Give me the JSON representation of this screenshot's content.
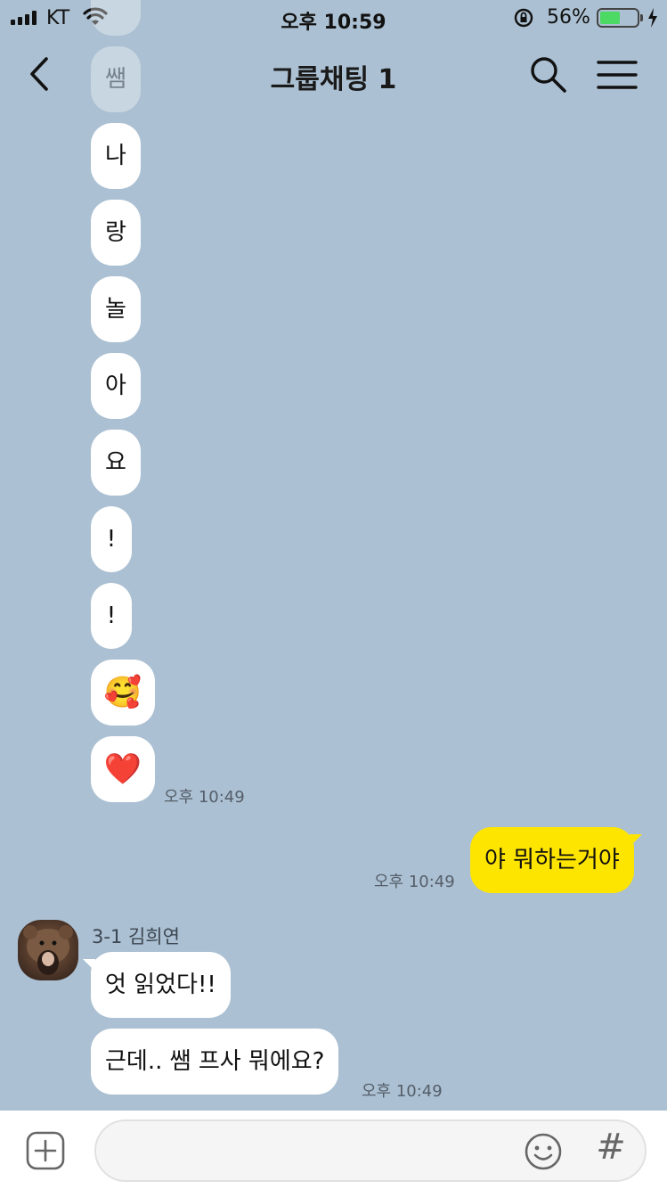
{
  "status_bar": {
    "carrier": "KT",
    "time": "오후 10:59",
    "battery_percent": "56%",
    "battery_level": 0.56,
    "signal_bars": 4,
    "battery_color": "#4cd964"
  },
  "header": {
    "title": "그룹채팅 1",
    "back_icon": "chevron-left-icon",
    "search_icon": "search-icon",
    "menu_icon": "hamburger-menu-icon"
  },
  "messages": {
    "faded_top": "쌤",
    "chars": [
      "나",
      "랑",
      "놀",
      "아",
      "요",
      "!",
      "!"
    ],
    "emoji_smile": "🥰",
    "emoji_heart": "❤️",
    "time_1": "오후 10:49",
    "mine_text": "야 뭐하는거야",
    "mine_time": "오후 10:49",
    "sender_name": "3-1 김희연",
    "reply_1": "엇 읽었다!!",
    "reply_2": "근데.. 쌤 프사 뭐에요?",
    "reply_time": "오후 10:49"
  },
  "input_bar": {
    "placeholder": "",
    "hashtag": "#",
    "attach_icon": "plus-square-icon",
    "emoji_icon": "smiley-icon"
  },
  "colors": {
    "background": "#abc0d2",
    "my_bubble": "#fee500",
    "other_bubble": "#ffffff"
  }
}
